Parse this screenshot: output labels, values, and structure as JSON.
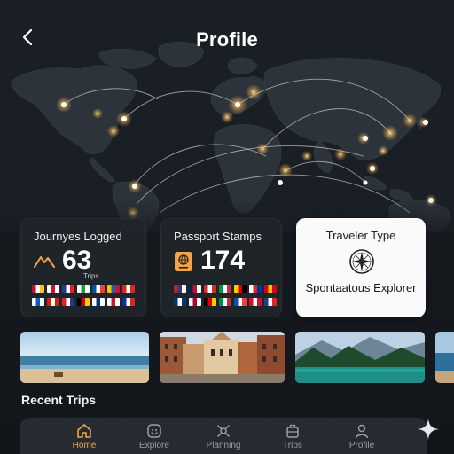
{
  "header": {
    "title": "Profile",
    "back_icon": "chevron-left-icon"
  },
  "stats": {
    "journeys": {
      "title": "Journyes Logged",
      "value": "63",
      "unit": "Trips",
      "icon": "mountain-icon",
      "flags": [
        [
          "#c8102e",
          "#ffffff",
          "#f7c52b"
        ],
        [
          "#ffffff",
          "#cf142b",
          "#ffffff"
        ],
        [
          "#1e3d8f",
          "#ffffff",
          "#e41e2b"
        ],
        [
          "#ffffff",
          "#1b9a4a",
          "#ffffff"
        ],
        [
          "#0055a4",
          "#ffffff",
          "#ef4135"
        ],
        [
          "#f5c400",
          "#1e5eb6",
          "#d21034"
        ],
        [
          "#d52b1e",
          "#ffffff",
          "#d52b1e"
        ],
        [
          "#ffffff",
          "#0a5bc2",
          "#ffffff"
        ],
        [
          "#d81e05",
          "#ffffff",
          "#d81e05"
        ],
        [
          "#e41e2b",
          "#ffffff",
          "#1e3d8f"
        ],
        [
          "#000000",
          "#dd0000",
          "#ffce00"
        ],
        [
          "#ffffff",
          "#003580",
          "#ffffff"
        ],
        [
          "#ffffff",
          "#cf142b",
          "#ffffff"
        ],
        [
          "#0033a0",
          "#ffffff",
          "#d52b1e"
        ]
      ]
    },
    "passport": {
      "title": "Passport Stamps",
      "value": "174",
      "icon": "passport-icon",
      "flags": [
        [
          "#b22234",
          "#3c3b6e",
          "#ffffff"
        ],
        [
          "#012169",
          "#c8102e",
          "#ffffff"
        ],
        [
          "#d52b1e",
          "#ffffff",
          "#d52b1e"
        ],
        [
          "#009246",
          "#ffffff",
          "#ce2b37"
        ],
        [
          "#ffce00",
          "#dd0000",
          "#000000"
        ],
        [
          "#ffffff",
          "#d52b1e",
          "#0033a0"
        ],
        [
          "#c60b1e",
          "#ffc400",
          "#c60b1e"
        ],
        [
          "#003580",
          "#ffffff",
          "#003580"
        ],
        [
          "#ffffff",
          "#bc002d",
          "#ffffff"
        ],
        [
          "#000000",
          "#dd0000",
          "#ffce00"
        ],
        [
          "#009246",
          "#ffffff",
          "#ce2b37"
        ],
        [
          "#0055a4",
          "#ffffff",
          "#ef4135"
        ],
        [
          "#d21034",
          "#ffffff",
          "#d21034"
        ],
        [
          "#1e3d8f",
          "#ffffff",
          "#e41e2b"
        ]
      ]
    },
    "traveler": {
      "title": "Traveler Type",
      "name": "Spontaatous Explorer",
      "icon": "compass-icon"
    }
  },
  "photos": [
    "beach-photo",
    "old-town-photo",
    "mountain-lake-photo",
    "coast-photo"
  ],
  "recent_trips": {
    "title": "Recent Trips"
  },
  "nav": {
    "active": "home",
    "items": [
      {
        "key": "home",
        "label": "Home",
        "icon": "home-icon"
      },
      {
        "key": "explore",
        "label": "Explore",
        "icon": "explore-icon"
      },
      {
        "key": "planning",
        "label": "Planning",
        "icon": "planning-icon"
      },
      {
        "key": "trips",
        "label": "Trips",
        "icon": "suitcase-icon"
      },
      {
        "key": "profile",
        "label": "Profile",
        "icon": "user-icon"
      }
    ]
  },
  "colors": {
    "accent": "#f3a44a",
    "background": "#14181d",
    "card": "#20252b",
    "card_light": "#fafafa",
    "city_light": "#ffd98a"
  }
}
